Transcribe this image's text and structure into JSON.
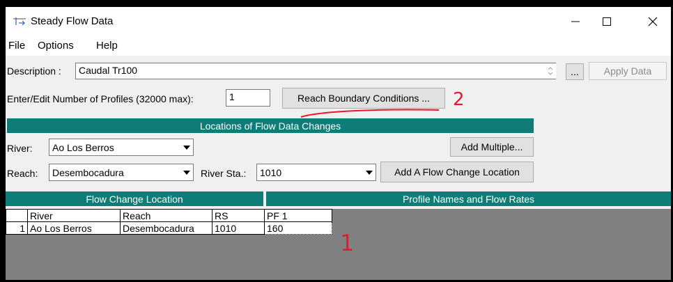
{
  "window": {
    "title": "Steady Flow Data",
    "app_icon": "flow-data-icon"
  },
  "menu": {
    "items": [
      "File",
      "Options",
      "Help"
    ]
  },
  "description": {
    "label": "Description :",
    "value": "Caudal Tr100",
    "browse_label": "...",
    "apply_label": "Apply Data"
  },
  "profiles": {
    "label": "Enter/Edit Number of Profiles (32000 max):",
    "value": "1",
    "reach_bc_label": "Reach Boundary Conditions ..."
  },
  "locations": {
    "header": "Locations of Flow Data Changes",
    "river_label": "River:",
    "river_value": "Ao Los Berros",
    "add_multiple_label": "Add Multiple...",
    "reach_label": "Reach:",
    "reach_value": "Desembocadura",
    "station_label": "River Sta.:",
    "station_value": "1010",
    "add_flow_label": "Add A Flow Change Location"
  },
  "table": {
    "flow_change_header": "Flow Change Location",
    "profile_header": "Profile Names and Flow Rates",
    "columns": [
      "",
      "River",
      "Reach",
      "RS",
      "PF 1"
    ],
    "rows": [
      [
        "1",
        "Ao Los Berros",
        "Desembocadura",
        "1010",
        "160"
      ]
    ]
  },
  "annotations": {
    "mark_1": "1",
    "mark_2": "2"
  },
  "colors": {
    "teal": "#0f7d77",
    "annotation_red": "#e8192c"
  }
}
